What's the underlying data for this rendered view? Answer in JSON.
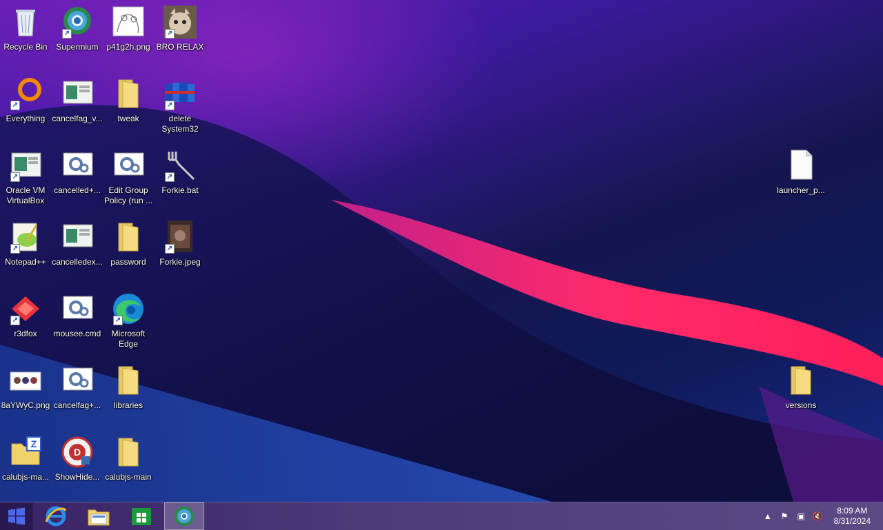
{
  "desktop": {
    "icons": [
      {
        "label": "Recycle Bin"
      },
      {
        "label": "Supermium"
      },
      {
        "label": "p41g2h.png"
      },
      {
        "label": "BRO RELAX"
      },
      {
        "label": "Everything"
      },
      {
        "label": "cancelfag_v..."
      },
      {
        "label": "tweak"
      },
      {
        "label": "delete System32"
      },
      {
        "label": "Oracle VM VirtualBox"
      },
      {
        "label": "cancelled+..."
      },
      {
        "label": "Edit Group Policy (run ..."
      },
      {
        "label": "Forkie.bat"
      },
      {
        "label": "Notepad++"
      },
      {
        "label": "cancelledex..."
      },
      {
        "label": "password"
      },
      {
        "label": "Forkie.jpeg"
      },
      {
        "label": "r3dfox"
      },
      {
        "label": "mousee.cmd"
      },
      {
        "label": "Microsoft Edge"
      },
      {
        "label": "8aYWyC.png"
      },
      {
        "label": "cancelfag+..."
      },
      {
        "label": "libraries"
      },
      {
        "label": "calubjs-ma..."
      },
      {
        "label": "ShowHide..."
      },
      {
        "label": "calubjs-main"
      },
      {
        "label": "launcher_p..."
      },
      {
        "label": "versions"
      }
    ]
  },
  "taskbar": {
    "start_icon": "windows-logo-icon",
    "pinned": [
      "internet-explorer-icon",
      "file-explorer-icon",
      "store-icon",
      "supermium-icon"
    ],
    "clock": {
      "time": "8:09 AM",
      "date": "8/31/2024"
    }
  }
}
